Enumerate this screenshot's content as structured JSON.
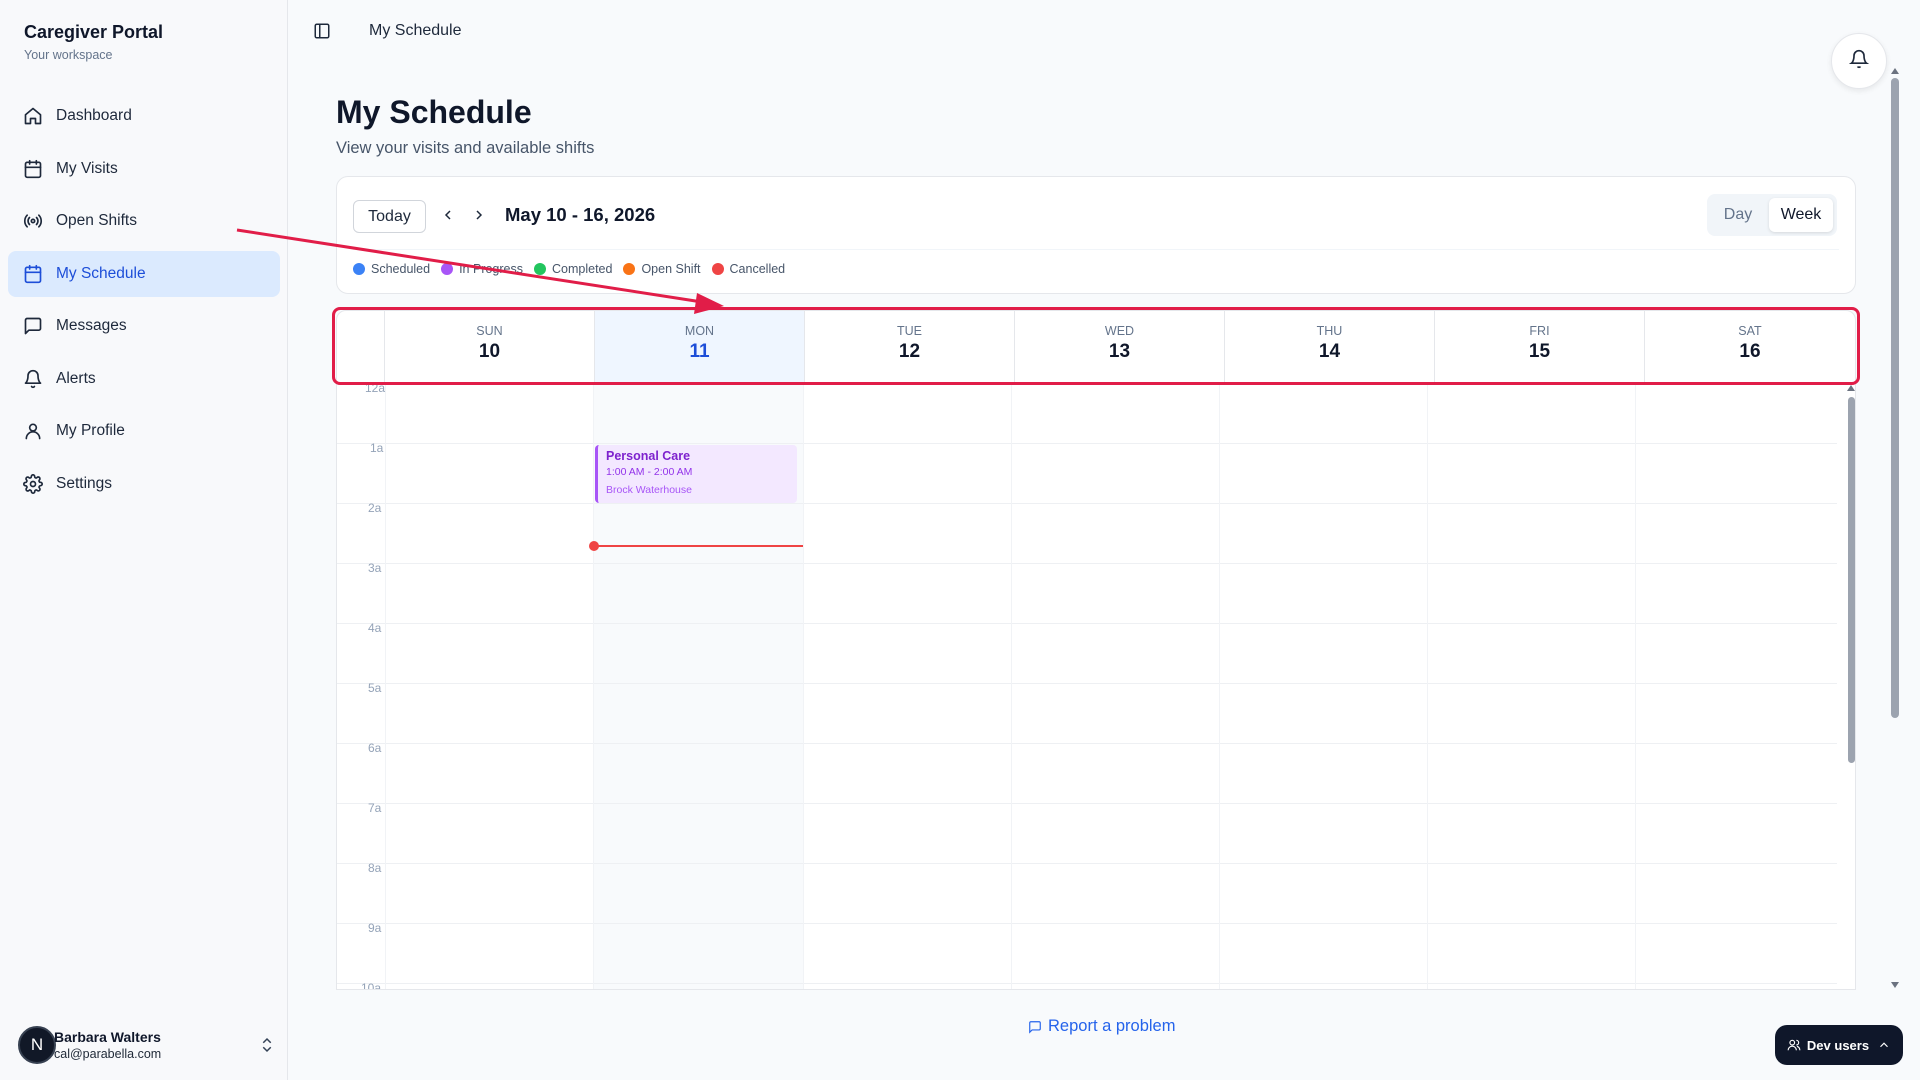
{
  "brand": {
    "title": "Caregiver Portal",
    "subtitle": "Your workspace"
  },
  "sidebar": {
    "items": [
      {
        "label": "Dashboard",
        "icon": "home-icon"
      },
      {
        "label": "My Visits",
        "icon": "calendar-icon"
      },
      {
        "label": "Open Shifts",
        "icon": "broadcast-icon"
      },
      {
        "label": "My Schedule",
        "icon": "calendar-icon",
        "active": true
      },
      {
        "label": "Messages",
        "icon": "message-square-icon"
      },
      {
        "label": "Alerts",
        "icon": "bell-icon"
      },
      {
        "label": "My Profile",
        "icon": "user-icon"
      },
      {
        "label": "Settings",
        "icon": "gear-icon"
      }
    ]
  },
  "user": {
    "initial": "N",
    "name": "Barbara Walters",
    "email": "cal@parabella.com"
  },
  "topbar": {
    "breadcrumb": "My Schedule"
  },
  "page": {
    "title": "My Schedule",
    "subtitle": "View your visits and available shifts"
  },
  "controls": {
    "today_label": "Today",
    "range": "May 10 - 16, 2026",
    "views": {
      "day": "Day",
      "week": "Week",
      "selected": "Week"
    }
  },
  "legend": [
    {
      "label": "Scheduled",
      "color": "#3b82f6"
    },
    {
      "label": "In Progress",
      "color": "#a855f7"
    },
    {
      "label": "Completed",
      "color": "#22c55e"
    },
    {
      "label": "Open Shift",
      "color": "#f97316"
    },
    {
      "label": "Cancelled",
      "color": "#ef4444"
    }
  ],
  "calendar": {
    "days": [
      {
        "dow": "SUN",
        "num": "10"
      },
      {
        "dow": "MON",
        "num": "11",
        "today": true
      },
      {
        "dow": "TUE",
        "num": "12"
      },
      {
        "dow": "WED",
        "num": "13"
      },
      {
        "dow": "THU",
        "num": "14"
      },
      {
        "dow": "FRI",
        "num": "15"
      },
      {
        "dow": "SAT",
        "num": "16"
      }
    ],
    "hours": [
      "12a",
      "1a",
      "2a",
      "3a",
      "4a",
      "5a",
      "6a",
      "7a",
      "8a",
      "9a",
      "10a"
    ],
    "event": {
      "title": "Personal Care",
      "time": "1:00 AM - 2:00 AM",
      "client": "Brock Waterhouse",
      "status": "In Progress",
      "day": "MON"
    }
  },
  "footer": {
    "report_label": "Report a problem",
    "dev_users_label": "Dev users"
  },
  "colors": {
    "accent": "#1d4ed8",
    "annotation": "#e11d48",
    "now_line": "#ef4444"
  }
}
